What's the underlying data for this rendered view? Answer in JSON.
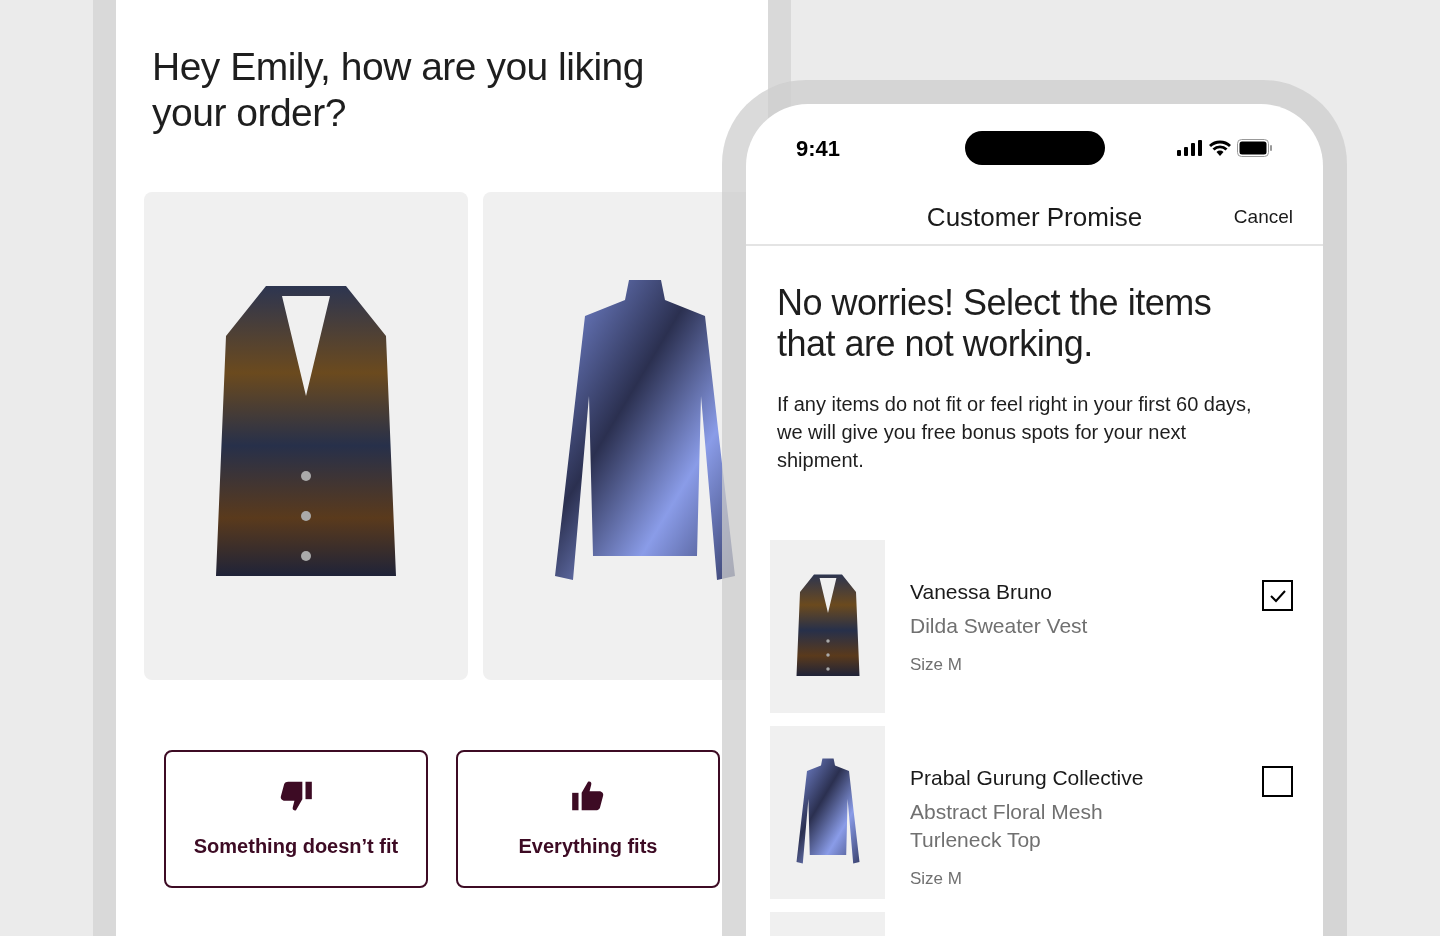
{
  "feedback": {
    "heading": "Hey Emily, how are you liking your order?",
    "products": [
      {
        "kind": "vest"
      },
      {
        "kind": "top"
      }
    ],
    "buttons": [
      {
        "kind": "down",
        "label": "Something doesn’t fit"
      },
      {
        "kind": "up",
        "label": "Everything fits"
      }
    ]
  },
  "phone": {
    "time": "9:41",
    "nav": {
      "title": "Customer Promise",
      "action": "Cancel"
    },
    "heading": "No worries! Select the items that are not working.",
    "body": "If any items do not fit or feel right in your first 60 days, we will give you free bonus spots for your next shipment.",
    "items": [
      {
        "kind": "vest",
        "brand": "Vanessa Bruno",
        "name": "Dilda Sweater Vest",
        "size": "Size M",
        "checked": true
      },
      {
        "kind": "top",
        "brand": "Prabal Gurung Collective",
        "name": "Abstract Floral Mesh Turleneck Top",
        "size": "Size M",
        "checked": false
      },
      {
        "kind": "blank"
      }
    ]
  }
}
